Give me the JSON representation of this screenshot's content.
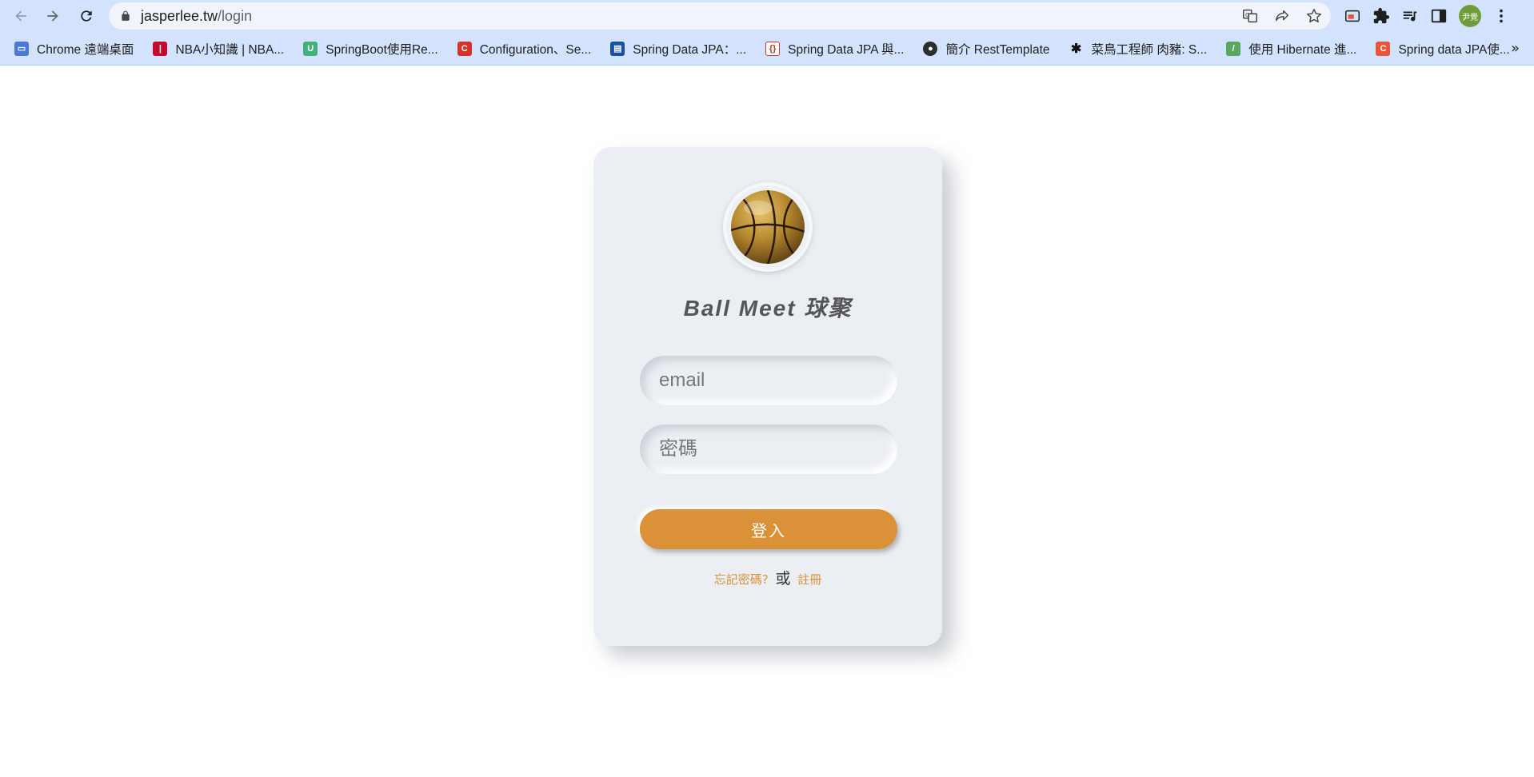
{
  "browser": {
    "url_host": "jasperlee.tw",
    "url_path": "/login",
    "profile_initials": "尹覺",
    "bookmarks": [
      {
        "label": "Chrome 遠端桌面",
        "icon": "chrome-remote-icon",
        "color": "#4a7bd1"
      },
      {
        "label": "NBA小知識 | NBA...",
        "icon": "nba-icon",
        "color": "#c9082a"
      },
      {
        "label": "SpringBoot使用Re...",
        "icon": "springboot-icon",
        "color": "#43b07a"
      },
      {
        "label": "Configuration、Se...",
        "icon": "c-icon",
        "color": "#d73229"
      },
      {
        "label": "Spring Data JPA：...",
        "icon": "blog-icon",
        "color": "#1a4fa0"
      },
      {
        "label": "Spring Data JPA 與...",
        "icon": "braces-icon",
        "color": "#c0392b"
      },
      {
        "label": "簡介 RestTemplate",
        "icon": "mickey-icon",
        "color": "#2d2d2d"
      },
      {
        "label": "菜鳥工程師 肉豬: S...",
        "icon": "star-burst-icon",
        "color": "#111111"
      },
      {
        "label": "使用 Hibernate 進...",
        "icon": "leaf-icon",
        "color": "#5aa661"
      },
      {
        "label": "Spring data JPA使...",
        "icon": "c-icon",
        "color": "#e8553b"
      }
    ]
  },
  "login": {
    "title": "Ball Meet 球聚",
    "email_placeholder": "email",
    "password_placeholder": "密碼",
    "login_label": "登入",
    "forgot_label": "忘記密碼?",
    "or_label": "或",
    "register_label": "註冊",
    "accent_color": "#db9137"
  }
}
